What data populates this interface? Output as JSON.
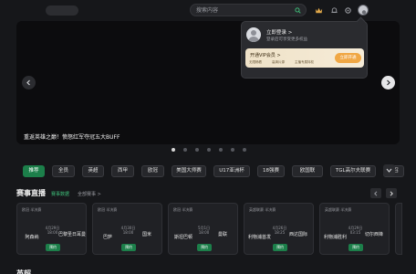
{
  "header": {
    "search_placeholder": "搜索内容",
    "icons": [
      "search-icon",
      "crown-icon",
      "bell-icon",
      "settings-icon",
      "avatar"
    ]
  },
  "banner": {
    "caption": "重返英雄之巅！愤怒红军夺冠五大BUFF",
    "slide_count": 7,
    "active_slide": 1
  },
  "popup": {
    "login_label": "立即登录 >",
    "login_sub": "登录后可享受更多权益",
    "vip_title": "开通VIP会员 >",
    "vip_perks": [
      "无限畅看",
      "高清片源",
      "主播专属特权"
    ],
    "vip_button": "立即开通"
  },
  "categories": {
    "items": [
      "推荐",
      "全员",
      "英超",
      "西甲",
      "欧冠",
      "美国大师赛",
      "U17亚洲杯",
      "18强赛",
      "欧国联",
      "TGL高尔夫联赛",
      "拂召"
    ],
    "active_index": 0
  },
  "live": {
    "title": "赛事直播",
    "tab_active": "赛事数据",
    "tab_inactive": "全部赛事 >",
    "cards": [
      {
        "league": "欧冠 半决赛",
        "date": "4月29日",
        "time": "18:00",
        "home": "阿森纳",
        "away": "巴黎圣日耳曼",
        "button": "预约"
      },
      {
        "league": "欧冠 半决赛",
        "date": "4月30日",
        "time": "18:00",
        "home": "巴萨",
        "away": "国米",
        "button": "预约"
      },
      {
        "league": "欧冠 半决赛",
        "date": "5月1日",
        "time": "18:00",
        "home": "斯坦巴顿",
        "away": "曼联",
        "button": "预约"
      },
      {
        "league": "英超联赛 半决赛",
        "date": "4月26日",
        "time": "18:25",
        "home": "利物浦首发",
        "away": "西达国际",
        "button": "预约"
      },
      {
        "league": "英超联赛 半决赛",
        "date": "4月29日",
        "time": "03:15",
        "home": "利物浦胜利",
        "away": "切尔西锋",
        "button": "预约"
      }
    ]
  },
  "bottom": {
    "title": "英超"
  },
  "colors": {
    "accent_green": "#1c7f4a",
    "background": "#16171a",
    "vip_orange": "#f0a744"
  }
}
